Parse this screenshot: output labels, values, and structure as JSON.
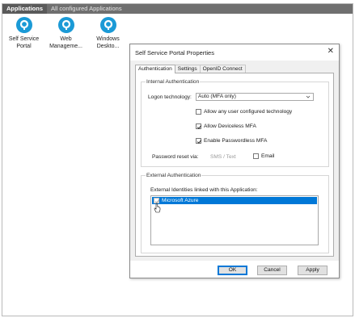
{
  "top_bar": {
    "tabs": [
      "Applications",
      "All configured Applications"
    ]
  },
  "tiles": [
    {
      "icon": "app-logo-icon",
      "line1": "Self Service",
      "line2": "Portal"
    },
    {
      "icon": "app-logo-icon",
      "line1": "Web",
      "line2": "Manageme..."
    },
    {
      "icon": "app-logo-icon",
      "line1": "Windows",
      "line2": "Deskto..."
    }
  ],
  "dialog": {
    "title": "Self Service Portal Properties",
    "close_glyph": "✕",
    "tabs": [
      "Authentication",
      "Settings",
      "OpenID Connect"
    ],
    "internal": {
      "title": "Internal Authentication",
      "logon_label": "Logon technology:",
      "logon_value": "Auto (MFA only)",
      "allow_any": "Allow any user configured technology",
      "allow_any_checked": false,
      "deviceless": "Allow Deviceless MFA",
      "deviceless_checked": true,
      "passwordless": "Enable Passwordless MFA",
      "passwordless_checked": true,
      "reset_label": "Password reset via:",
      "reset_sms": "SMS / Text",
      "reset_email": "Email",
      "reset_email_checked": false
    },
    "external": {
      "title": "External Authentication",
      "list_label": "External Identities linked with this Application:",
      "items": [
        {
          "label": "Microsoft Azure",
          "checked": true,
          "selected": true
        }
      ]
    },
    "buttons": {
      "ok": "OK",
      "cancel": "Cancel",
      "apply": "Apply"
    }
  },
  "colors": {
    "accent": "#1b9ad6",
    "selection": "#0078d7",
    "top_bar": "#6f6f6f"
  }
}
